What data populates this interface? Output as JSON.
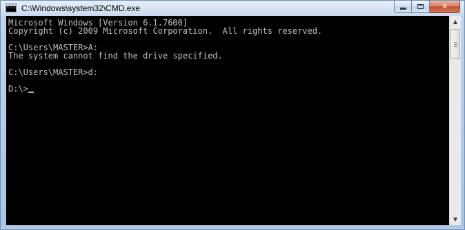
{
  "window": {
    "title": "C:\\Windows\\system32\\CMD.exe",
    "icon_label": "C:\\"
  },
  "caption_buttons": {
    "minimize": "minimize-icon",
    "maximize": "maximize-icon",
    "close": "✕"
  },
  "console": {
    "lines": [
      "Microsoft Windows [Version 6.1.7600]",
      "Copyright (c) 2009 Microsoft Corporation.  All rights reserved.",
      "",
      "C:\\Users\\MASTER>A:",
      "The system cannot find the drive specified.",
      "",
      "C:\\Users\\MASTER>d:",
      "",
      "D:\\>"
    ],
    "colors": {
      "background": "#000000",
      "text": "#c0c0c0"
    }
  },
  "scrollbar": {
    "up_arrow": "▲",
    "down_arrow": "▼"
  }
}
